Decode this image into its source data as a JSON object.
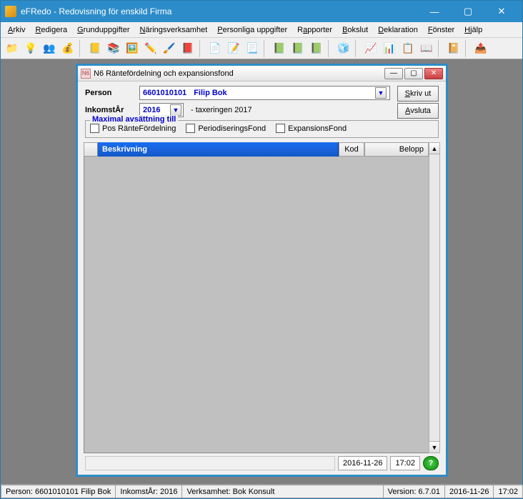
{
  "app": {
    "title": "eFRedo - Redovisning för enskild Firma"
  },
  "menus": {
    "arkiv": "Arkiv",
    "redigera": "Redigera",
    "grunduppgifter": "Grunduppgifter",
    "naringsverksamhet": "Näringsverksamhet",
    "personliga": "Personliga uppgifter",
    "rapporter": "Rapporter",
    "bokslut": "Bokslut",
    "deklaration": "Deklaration",
    "fonster": "Fönster",
    "hjalp": "Hjälp"
  },
  "child": {
    "title": "N6 Räntefördelning och expansionsfond",
    "person_label": "Person",
    "person_id": "6601010101",
    "person_name": "Filip Bok",
    "year_label": "InkomstÅr",
    "year_value": "2016",
    "taxering_text": "- taxeringen 2017",
    "btn_skrivut": "Skriv ut",
    "btn_avsluta": "Avsluta",
    "fieldset_legend": "Maximal avsättning till",
    "chk_pos": "Pos RänteFördelning",
    "chk_period": "PeriodiseringsFond",
    "chk_expansion": "ExpansionsFond",
    "cols": {
      "beskrivning": "Beskrivning",
      "kod": "Kod",
      "belopp": "Belopp"
    },
    "status_date": "2016-11-26",
    "status_time": "17:02"
  },
  "status": {
    "person": "Person: 6601010101  Filip Bok",
    "inkomstar": "InkomstÅr: 2016",
    "verksamhet": "Verksamhet: Bok Konsult",
    "version": "Version: 6.7.01",
    "date": "2016-11-26",
    "time": "17:02"
  },
  "chart_data": {
    "type": "table",
    "columns": [
      "Beskrivning",
      "Kod",
      "Belopp"
    ],
    "rows": []
  }
}
